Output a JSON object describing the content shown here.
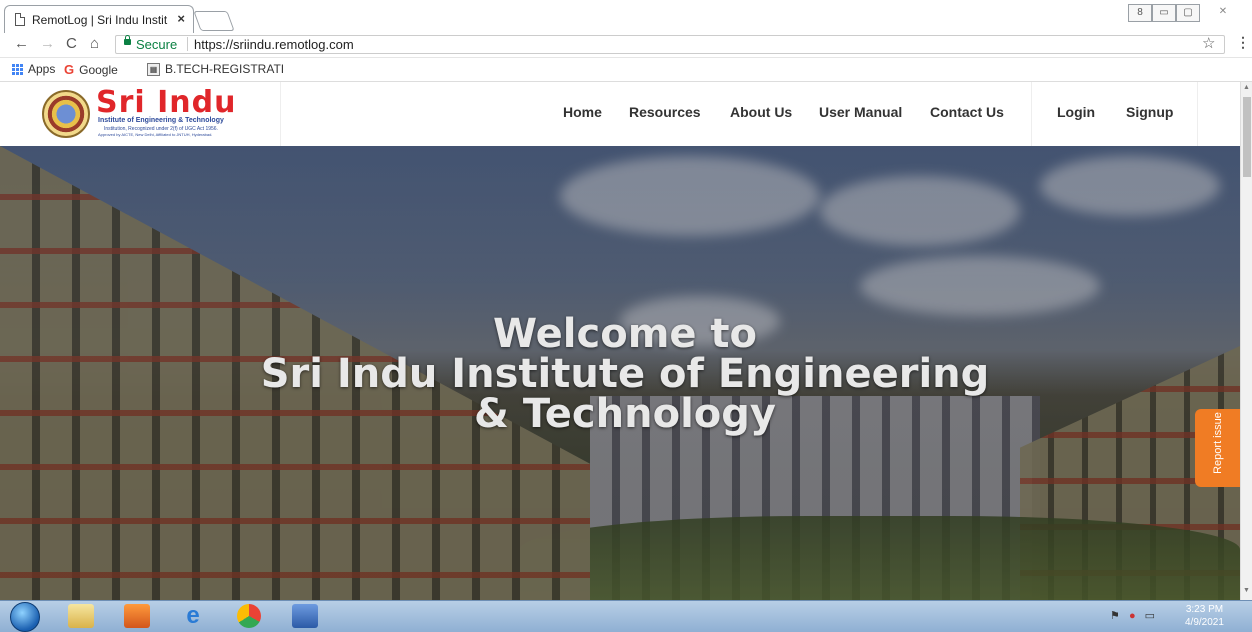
{
  "browser": {
    "tab_title": "RemotLog | Sri Indu Instit",
    "tab_close": "×",
    "secure_label": "Secure",
    "url": "https://sriindu.remotlog.com",
    "window_controls": [
      "8",
      "▭",
      "▢",
      "✕"
    ]
  },
  "bookmarks": [
    {
      "label": "Apps",
      "icon": "apps-grid-icon"
    },
    {
      "label": "Google",
      "icon": "google-icon"
    },
    {
      "label": "B.TECH-REGISTRATI",
      "icon": "document-icon"
    }
  ],
  "site": {
    "logo_main": "Sri Indu",
    "logo_sub": "Institute of Engineering & Technology",
    "logo_sub2": "Institution, Recognized under 2(f) of UGC Act 1956.",
    "logo_sub3": "Approved by AICTE, New Delhi, Affiliated to JNTUH, Hyderabad.",
    "nav": [
      "Home",
      "Resources",
      "About Us",
      "User Manual",
      "Contact Us"
    ],
    "auth": [
      "Login",
      "Signup"
    ]
  },
  "hero": {
    "line1": "Welcome to",
    "line2": "Sri Indu Institute of Engineering",
    "line3": "& Technology"
  },
  "report_issue": "Report issue",
  "taskbar": {
    "time": "3:23 PM",
    "date": "4/9/2021"
  },
  "colors": {
    "accent_red": "#e0262a",
    "report_orange": "#f07c24",
    "secure_green": "#0b8043"
  }
}
